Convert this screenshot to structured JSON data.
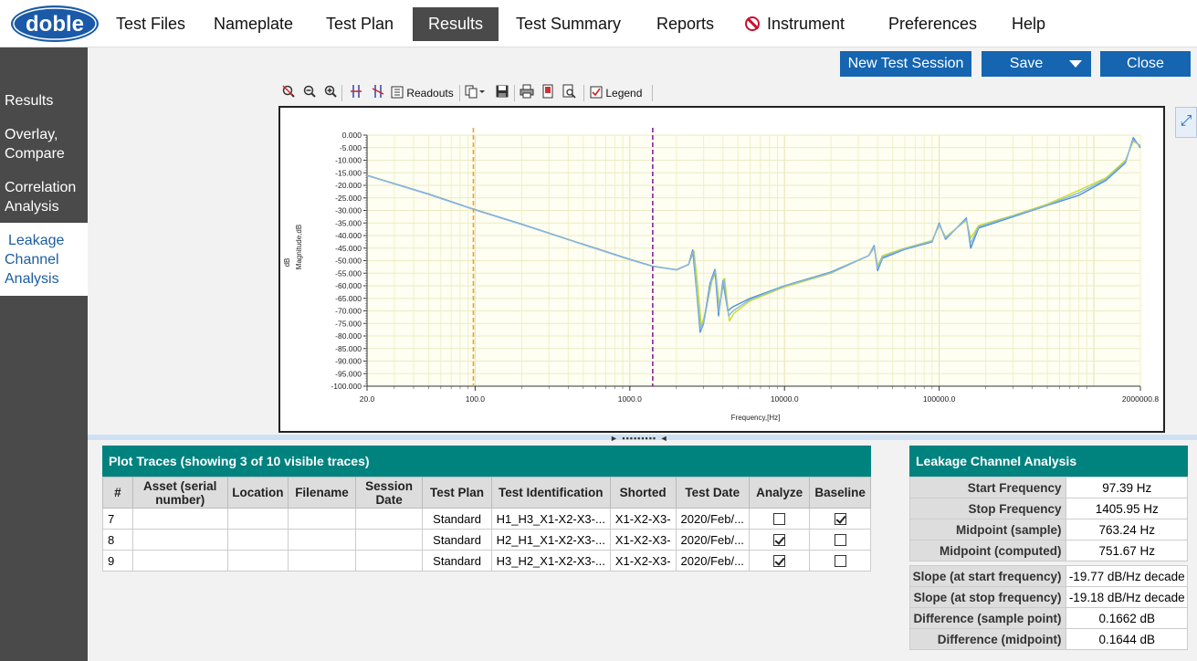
{
  "app": {
    "logo_text": "doble",
    "menu": [
      "Test Files",
      "Nameplate",
      "Test Plan",
      "Results",
      "Test Summary",
      "Reports",
      "Instrument",
      "Preferences",
      "Help"
    ],
    "active_menu": "Results"
  },
  "sidebar": {
    "items": [
      {
        "lines": [
          "Results"
        ]
      },
      {
        "lines": [
          "Overlay,",
          "Compare"
        ]
      },
      {
        "lines": [
          "Correlation",
          "Analysis"
        ]
      },
      {
        "lines": [
          "Leakage",
          "Channel",
          "Analysis"
        ]
      }
    ],
    "active_index": 3
  },
  "actions": {
    "new_session": "New Test Session",
    "save": "Save",
    "close": "Close"
  },
  "toolbar": {
    "readouts": "Readouts",
    "legend": "Legend"
  },
  "chart_data": {
    "type": "line",
    "xlabel": "Frequency,[Hz]",
    "ylabel_unit": "dB",
    "ylabel": "Magnitude,dB",
    "x_scale": "log",
    "xlim": [
      20.0,
      2000000.8
    ],
    "ylim": [
      -100.0,
      0.0
    ],
    "x_tick_labels": [
      "20.0",
      "100.0",
      "1000.0",
      "10000.0",
      "100000.0",
      "2000000.8"
    ],
    "x_ticks": [
      20,
      100,
      1000,
      10000,
      100000,
      2000000.8
    ],
    "y_tick_labels": [
      "0.000",
      "-5.000",
      "-10.000",
      "-15.000",
      "-20.000",
      "-25.000",
      "-30.000",
      "-35.000",
      "-40.000",
      "-45.000",
      "-50.000",
      "-55.000",
      "-60.000",
      "-65.000",
      "-70.000",
      "-75.000",
      "-80.000",
      "-85.000",
      "-90.000",
      "-95.000",
      "-100.000"
    ],
    "grid": true,
    "markers": [
      {
        "x": 97.39,
        "color": "#f0a020"
      },
      {
        "x": 1405.95,
        "color": "#8a1fa0"
      }
    ],
    "series": [
      {
        "color": "#c8e020",
        "points": [
          [
            20,
            -16.0
          ],
          [
            50,
            -23.5
          ],
          [
            97.39,
            -29.5
          ],
          [
            200,
            -35.5
          ],
          [
            500,
            -43.5
          ],
          [
            1000,
            -49.5
          ],
          [
            1405.95,
            -52.2
          ],
          [
            2000,
            -53.7
          ],
          [
            2400,
            -51.5
          ],
          [
            2600,
            -46.3
          ],
          [
            2750,
            -60
          ],
          [
            2900,
            -76
          ],
          [
            3100,
            -70
          ],
          [
            3400,
            -58
          ],
          [
            3600,
            -55
          ],
          [
            3800,
            -68
          ],
          [
            4100,
            -57
          ],
          [
            4400,
            -74
          ],
          [
            4700,
            -71
          ],
          [
            6000,
            -66
          ],
          [
            10000,
            -60.5
          ],
          [
            20000,
            -55
          ],
          [
            35000,
            -48
          ],
          [
            38000,
            -45
          ],
          [
            40000,
            -52
          ],
          [
            43000,
            -48
          ],
          [
            60000,
            -45
          ],
          [
            90000,
            -42
          ],
          [
            100000,
            -36
          ],
          [
            110000,
            -40.5
          ],
          [
            150000,
            -34
          ],
          [
            160000,
            -41
          ],
          [
            180000,
            -36
          ],
          [
            300000,
            -32
          ],
          [
            500000,
            -27.5
          ],
          [
            800000,
            -22
          ],
          [
            1200000,
            -17
          ],
          [
            1600000,
            -10
          ],
          [
            1800000,
            -2.5
          ],
          [
            2000000,
            -4
          ]
        ]
      },
      {
        "color": "#4a90d9",
        "points": [
          [
            20,
            -16.0
          ],
          [
            50,
            -23.5
          ],
          [
            97.39,
            -29.5
          ],
          [
            200,
            -35.5
          ],
          [
            500,
            -43.5
          ],
          [
            1000,
            -49.5
          ],
          [
            1405.95,
            -52.2
          ],
          [
            2000,
            -53.6
          ],
          [
            2400,
            -51.5
          ],
          [
            2550,
            -45.7
          ],
          [
            2700,
            -62
          ],
          [
            2850,
            -78.5
          ],
          [
            3000,
            -75
          ],
          [
            3300,
            -59
          ],
          [
            3550,
            -53.5
          ],
          [
            3750,
            -72
          ],
          [
            4000,
            -58
          ],
          [
            4300,
            -70
          ],
          [
            4600,
            -68.5
          ],
          [
            6000,
            -65
          ],
          [
            10000,
            -60
          ],
          [
            20000,
            -54.5
          ],
          [
            35000,
            -48
          ],
          [
            38000,
            -44
          ],
          [
            40000,
            -54
          ],
          [
            43000,
            -49
          ],
          [
            60000,
            -45.5
          ],
          [
            90000,
            -42.5
          ],
          [
            100000,
            -35
          ],
          [
            110000,
            -41.5
          ],
          [
            150000,
            -33
          ],
          [
            160000,
            -45
          ],
          [
            180000,
            -37
          ],
          [
            300000,
            -32.5
          ],
          [
            500000,
            -28
          ],
          [
            800000,
            -24
          ],
          [
            1200000,
            -18
          ],
          [
            1600000,
            -11
          ],
          [
            1800000,
            -1
          ],
          [
            2000000,
            -5
          ]
        ]
      },
      {
        "color": "#8fb8e0",
        "points": [
          [
            20,
            -16.1
          ],
          [
            50,
            -23.6
          ],
          [
            97.39,
            -29.6
          ],
          [
            200,
            -35.6
          ],
          [
            500,
            -43.6
          ],
          [
            1000,
            -49.6
          ],
          [
            1405.95,
            -52.3
          ],
          [
            2000,
            -53.7
          ],
          [
            2400,
            -51.6
          ],
          [
            2580,
            -46
          ],
          [
            2720,
            -63
          ],
          [
            2870,
            -77.5
          ],
          [
            3050,
            -73
          ],
          [
            3350,
            -58.5
          ],
          [
            3580,
            -54
          ],
          [
            3770,
            -70.5
          ],
          [
            4050,
            -57.5
          ],
          [
            4350,
            -72
          ],
          [
            4650,
            -70
          ],
          [
            6000,
            -65.5
          ],
          [
            10000,
            -60.2
          ],
          [
            20000,
            -54.8
          ],
          [
            35000,
            -48
          ],
          [
            38000,
            -44.5
          ],
          [
            40000,
            -53
          ],
          [
            43000,
            -48.5
          ],
          [
            60000,
            -45.2
          ],
          [
            90000,
            -42.2
          ],
          [
            100000,
            -35.5
          ],
          [
            110000,
            -41
          ],
          [
            150000,
            -33.5
          ],
          [
            160000,
            -43
          ],
          [
            180000,
            -36.5
          ],
          [
            300000,
            -32.2
          ],
          [
            500000,
            -27.8
          ],
          [
            800000,
            -23
          ],
          [
            1200000,
            -17.5
          ],
          [
            1600000,
            -10.5
          ],
          [
            1800000,
            -1.8
          ],
          [
            2000000,
            -4.5
          ]
        ]
      }
    ]
  },
  "plot_traces": {
    "title": "Plot Traces (showing 3 of 10 visible traces)",
    "columns": [
      "#",
      "Asset (serial number)",
      "Location",
      "Filename",
      "Session Date",
      "Test Plan",
      "Test Identification",
      "Shorted",
      "Test Date",
      "Analyze",
      "Baseline"
    ],
    "rows": [
      {
        "num": "7",
        "asset": "",
        "location": "",
        "filename": "",
        "session_date": "",
        "test_plan": "Standard",
        "test_id": "H1_H3_X1-X2-X3-...",
        "shorted": "X1-X2-X3-",
        "test_date": "2020/Feb/...",
        "analyze": false,
        "baseline": true
      },
      {
        "num": "8",
        "asset": "",
        "location": "",
        "filename": "",
        "session_date": "",
        "test_plan": "Standard",
        "test_id": "H2_H1_X1-X2-X3-...",
        "shorted": "X1-X2-X3-",
        "test_date": "2020/Feb/...",
        "analyze": true,
        "baseline": false
      },
      {
        "num": "9",
        "asset": "",
        "location": "",
        "filename": "",
        "session_date": "",
        "test_plan": "Standard",
        "test_id": "H3_H2_X1-X2-X3-...",
        "shorted": "X1-X2-X3-",
        "test_date": "2020/Feb/...",
        "analyze": true,
        "baseline": false
      }
    ]
  },
  "leakage": {
    "title": "Leakage Channel Analysis",
    "group1": [
      {
        "label": "Start Frequency",
        "value": "97.39 Hz"
      },
      {
        "label": "Stop Frequency",
        "value": "1405.95 Hz"
      },
      {
        "label": "Midpoint (sample)",
        "value": "763.24 Hz"
      },
      {
        "label": "Midpoint (computed)",
        "value": "751.67 Hz"
      }
    ],
    "group2": [
      {
        "label": "Slope (at start frequency)",
        "value": "-19.77 dB/Hz decade"
      },
      {
        "label": "Slope (at stop frequency)",
        "value": "-19.18 dB/Hz decade"
      },
      {
        "label": "Difference (sample point)",
        "value": "0.1662 dB"
      },
      {
        "label": "Difference (midpoint)",
        "value": "0.1644 dB"
      }
    ]
  }
}
